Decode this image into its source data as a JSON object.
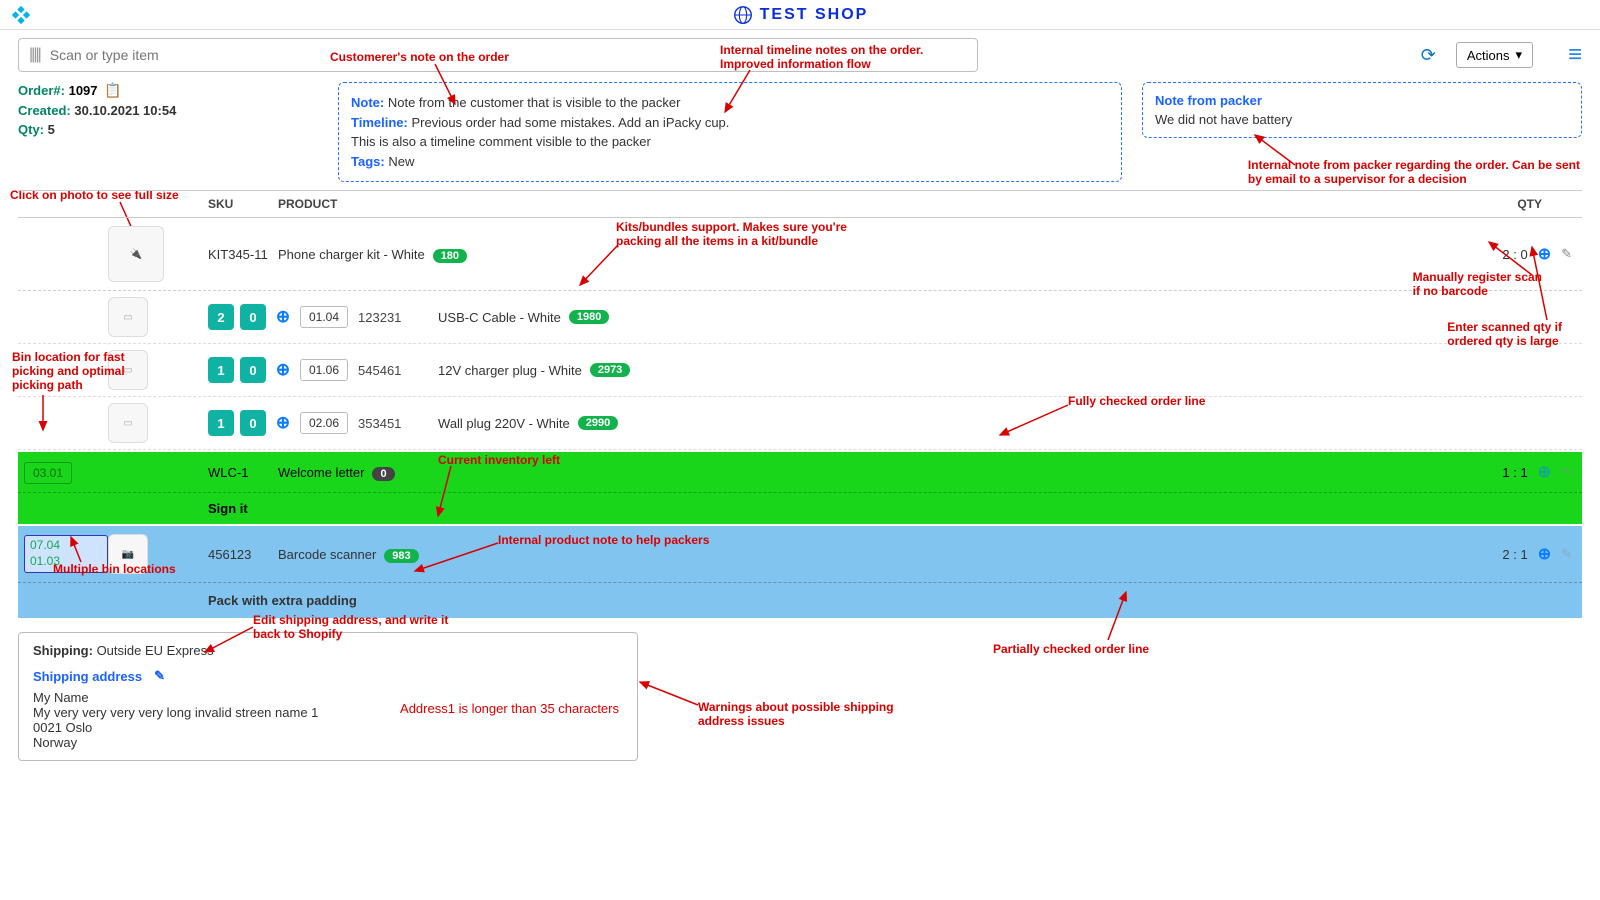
{
  "brand": "TEST SHOP",
  "scan_placeholder": "Scan or type item",
  "actions_label": "Actions",
  "order": {
    "label": "Order#:",
    "number": "1097",
    "created_label": "Created:",
    "created": "30.10.2021 10:54",
    "qty_label": "Qty:",
    "qty": "5"
  },
  "notes": {
    "note_label": "Note:",
    "note_text": "Note from the customer that is visible to the packer",
    "timeline_label": "Timeline:",
    "timeline_text1": "Previous order had some mistakes. Add an iPacky cup.",
    "timeline_text2": "This is also a timeline comment visible to the packer",
    "tags_label": "Tags:",
    "tags_text": "New"
  },
  "packer_note": {
    "label": "Note from packer",
    "text": "We did not have battery"
  },
  "headers": {
    "sku": "SKU",
    "product": "PRODUCT",
    "qty": "QTY"
  },
  "kit": {
    "sku": "KIT345-11",
    "name": "Phone charger kit - White",
    "inv": "180",
    "qty": "2 : 0",
    "items": [
      {
        "q1": "2",
        "q2": "0",
        "loc": "01.04",
        "sku": "123231",
        "name": "USB-C Cable - White",
        "inv": "1980"
      },
      {
        "q1": "1",
        "q2": "0",
        "loc": "01.06",
        "sku": "545461",
        "name": "12V charger plug - White",
        "inv": "2973"
      },
      {
        "q1": "1",
        "q2": "0",
        "loc": "02.06",
        "sku": "353451",
        "name": "Wall plug 220V - White",
        "inv": "2990"
      }
    ]
  },
  "full_line": {
    "loc": "03.01",
    "sku": "WLC-1",
    "name": "Welcome letter",
    "inv": "0",
    "qty": "1 : 1",
    "note": "Sign it"
  },
  "partial_line": {
    "locs": "07.04\n01.03",
    "sku": "456123",
    "name": "Barcode scanner",
    "inv": "983",
    "qty": "2 : 1",
    "note": "Pack with extra padding"
  },
  "shipping": {
    "label": "Shipping:",
    "method": "Outside EU Express",
    "addr_label": "Shipping address",
    "name": "My Name",
    "line1": "My very very very very long invalid streen name 1",
    "zipcity": "0021  Oslo",
    "country": "Norway",
    "warning": "Address1 is longer than 35 characters"
  },
  "annotations": {
    "a1": "Customerer's note on the order",
    "a2": "Internal timeline notes on the order.\nImproved information flow",
    "a3": "Click on photo to see full size",
    "a4": "Kits/bundles support. Makes sure you're\npacking all the items in a kit/bundle",
    "a5": "Manually register scan\nif no barcode",
    "a6": "Enter scanned qty if\nordered qty is large",
    "a7": "Bin location for fast\npicking and optimal\npicking path",
    "a8": "Fully checked order line",
    "a9": "Current inventory left",
    "a10": "Internal product note to help packers",
    "a11": "Multiple bin locations",
    "a12": "Partially checked order line",
    "a13": "Internal note from packer regarding the order. Can be sent\nby email to a supervisor for a decision",
    "a14": "Edit shipping address, and write it\nback to Shopify",
    "a15": "Warnings about possible shipping\naddress issues"
  }
}
